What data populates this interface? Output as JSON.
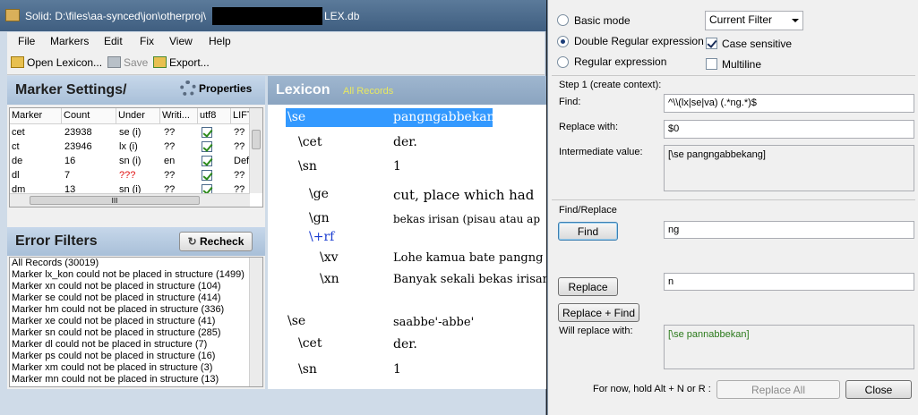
{
  "window": {
    "title_prefix": "Solid: D:\\files\\aa-synced\\jon\\otherproj\\",
    "title_suffix": "LEX.db"
  },
  "menu": [
    "File",
    "Markers",
    "Edit",
    "Fix",
    "View",
    "Help"
  ],
  "toolbar": {
    "open_label": "Open Lexicon...",
    "save_label": "Save",
    "export_label": "Export..."
  },
  "marker_settings": {
    "title": "Marker Settings/",
    "properties_label": "Properties",
    "columns": [
      "Marker",
      "Count",
      "Under",
      "Writi...",
      "utf8",
      "LIFT"
    ],
    "rows": [
      {
        "marker": "cet",
        "count": "23938",
        "under": "se (i)",
        "writing": "??",
        "utf8": true,
        "lift": "??"
      },
      {
        "marker": "ct",
        "count": "23946",
        "under": "lx (i)",
        "writing": "??",
        "utf8": true,
        "lift": "??"
      },
      {
        "marker": "de",
        "count": "16",
        "under": "sn (i)",
        "writing": "en",
        "utf8": true,
        "lift": "Def"
      },
      {
        "marker": "dl",
        "count": "7",
        "under": "???",
        "writing": "??",
        "utf8": true,
        "lift": "??"
      },
      {
        "marker": "dm",
        "count": "13",
        "under": "sn (i)",
        "writing": "??",
        "utf8": true,
        "lift": "??"
      }
    ],
    "scroll_glyph": "III"
  },
  "error_filters": {
    "title": "Error Filters",
    "recheck_label": "Recheck",
    "items": [
      "All Records (30019)",
      "Marker lx_kon could not be placed in structure (1499)",
      "Marker xn could not be placed in structure (104)",
      "Marker se could not be placed in structure (414)",
      "Marker hm could not be placed in structure (336)",
      "Marker xe could not be placed in structure (41)",
      "Marker sn could not be placed in structure (285)",
      "Marker dl could not be placed in structure (7)",
      "Marker ps could not be placed in structure (16)",
      "Marker xm could not be placed in structure (3)",
      "Marker mn could not be placed in structure (13)"
    ]
  },
  "lexicon": {
    "title": "Lexicon",
    "subtitle": "All Records",
    "lines": [
      {
        "marker": "\\se",
        "value": "pangngabbekang",
        "selected": true
      },
      {
        "marker": "\\cet",
        "value": "der."
      },
      {
        "marker": "\\sn",
        "value": "1"
      },
      {
        "marker": "\\ge",
        "value": "cut, place which had"
      },
      {
        "marker": "\\gn",
        "value": "bekas irisan (pisau atau ap"
      },
      {
        "marker": "\\+rf",
        "value": ""
      },
      {
        "marker": "\\xv",
        "value": "Lohe kamua bate pangng"
      },
      {
        "marker": "\\xn",
        "value": "Banyak sekali bekas irisan"
      },
      {
        "marker": "\\se",
        "value": "saabbe'-abbe'"
      },
      {
        "marker": "\\cet",
        "value": "der."
      },
      {
        "marker": "\\sn",
        "value": "1"
      }
    ]
  },
  "find_replace": {
    "mode_basic": "Basic mode",
    "mode_double": "Double Regular expression",
    "mode_regex": "Regular expression",
    "selected_mode": "Double Regular expression",
    "scope": "Current Filter",
    "case_sensitive_label": "Case sensitive",
    "case_sensitive": true,
    "multiline_label": "Multiline",
    "multiline": false,
    "step1_label": "Step 1 (create context):",
    "find_label": "Find:",
    "find_value": "^\\\\(lx|se|va) (.*ng.*)$",
    "replace_with_label": "Replace with:",
    "replace_with_value": "$0",
    "intermediate_label": "Intermediate value:",
    "intermediate_value": "[\\se pangngabbekang]",
    "section2_label": "Find/Replace",
    "find_button": "Find",
    "find2_value": "ng",
    "replace_button": "Replace",
    "replace2_value": "n",
    "replace_find_button": "Replace + Find",
    "will_replace_label": "Will replace with:",
    "will_replace_value": "[\\se pannabbekan]",
    "hint": "For now, hold Alt + N or R :",
    "replace_all_button": "Replace All",
    "close_button": "Close"
  },
  "colors": {
    "selection": "#3399ff",
    "rf_marker": "#1a3cd0",
    "will_replace": "#2a7a1a",
    "count_warning": "#e01010"
  }
}
